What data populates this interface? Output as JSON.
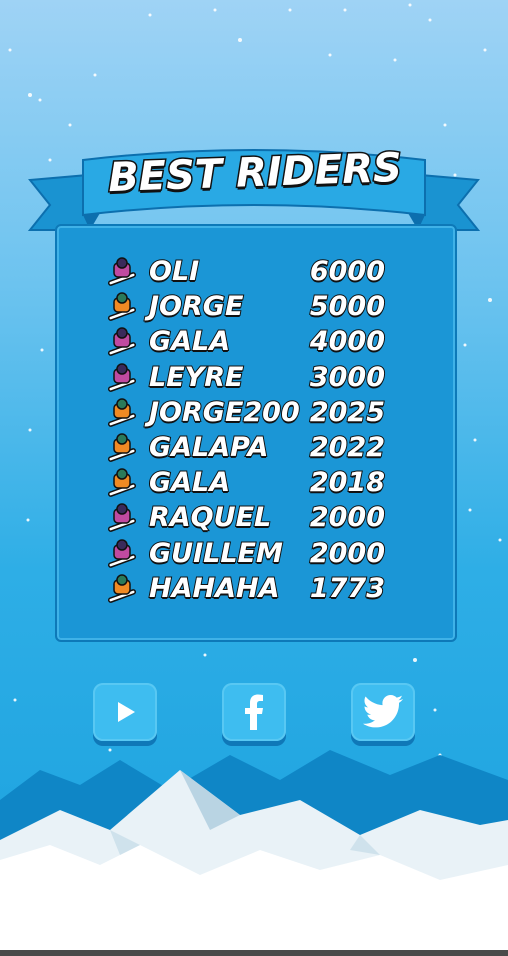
{
  "title": "BEST RIDERS",
  "leaderboard": [
    {
      "name": "OLI",
      "score": "6000",
      "icon": "purple-rider-icon",
      "color": "#c04aa0"
    },
    {
      "name": "JORGE",
      "score": "5000",
      "icon": "orange-rider-icon",
      "color": "#f08a24"
    },
    {
      "name": "GALA",
      "score": "4000",
      "icon": "purple-rider-icon",
      "color": "#c04aa0"
    },
    {
      "name": "LEYRE",
      "score": "3000",
      "icon": "purple-rider-icon",
      "color": "#c04aa0"
    },
    {
      "name": "JORGE200",
      "score": "2025",
      "icon": "orange-rider-icon",
      "color": "#f08a24"
    },
    {
      "name": "GALAPA",
      "score": "2022",
      "icon": "orange-rider-icon",
      "color": "#f08a24"
    },
    {
      "name": "GALA",
      "score": "2018",
      "icon": "orange-rider-icon",
      "color": "#f08a24"
    },
    {
      "name": "RAQUEL",
      "score": "2000",
      "icon": "purple-rider-icon",
      "color": "#c04aa0"
    },
    {
      "name": "GUILLEM",
      "score": "2000",
      "icon": "purple-rider-icon",
      "color": "#c04aa0"
    },
    {
      "name": "HAHAHA",
      "score": "1773",
      "icon": "orange-rider-icon",
      "color": "#f08a24"
    }
  ],
  "buttons": [
    {
      "icon": "play-icon"
    },
    {
      "icon": "facebook-icon"
    },
    {
      "icon": "twitter-icon"
    }
  ],
  "colors": {
    "accent": "#3ebdf0",
    "panel": "#1b96d6",
    "banner": "#29a9e4"
  }
}
